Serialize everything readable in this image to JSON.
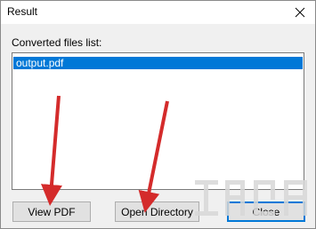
{
  "window": {
    "title": "Result"
  },
  "list": {
    "label": "Converted files list:",
    "items": [
      "output.pdf"
    ]
  },
  "buttons": {
    "view_pdf": "View PDF",
    "open_directory": "Open Directory",
    "close": "Close"
  },
  "colors": {
    "selection": "#0078d7",
    "arrow": "#d42b2b",
    "button_face": "#e1e1e1",
    "window_bg": "#f0f0f0"
  },
  "icons": {
    "close": "close-icon",
    "arrow": "red-arrow-annotation"
  }
}
